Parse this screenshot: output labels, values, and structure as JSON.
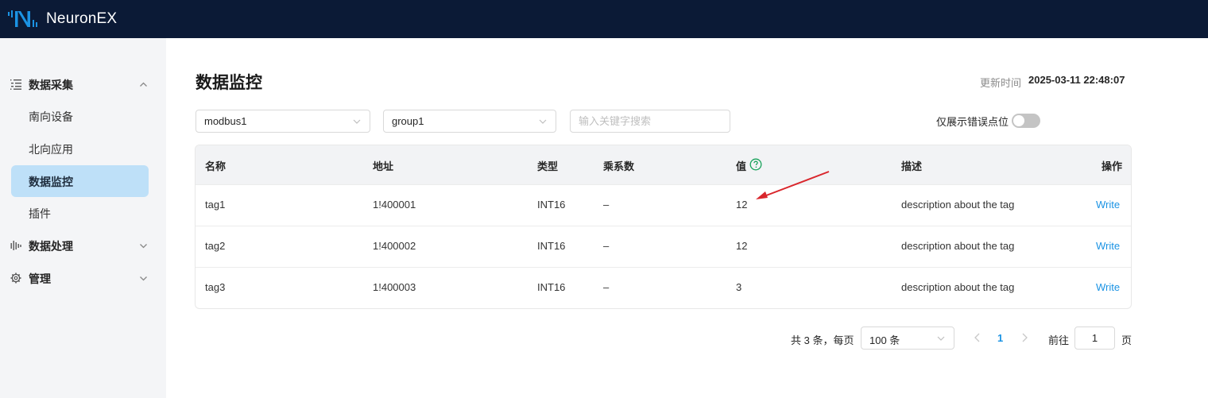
{
  "app": {
    "name": "NeuronEX"
  },
  "sidebar": {
    "groups": [
      {
        "label": "数据采集",
        "items": [
          {
            "label": "南向设备"
          },
          {
            "label": "北向应用"
          },
          {
            "label": "数据监控",
            "active": true
          },
          {
            "label": "插件"
          }
        ]
      },
      {
        "label": "数据处理"
      },
      {
        "label": "管理"
      }
    ]
  },
  "page": {
    "title": "数据监控",
    "update_label": "更新时间",
    "update_time": "2025-03-11 22:48:07"
  },
  "filters": {
    "node": "modbus1",
    "group": "group1",
    "search_placeholder": "输入关键字搜索",
    "error_only_label": "仅展示错误点位",
    "error_only": false
  },
  "table": {
    "columns": [
      "名称",
      "地址",
      "类型",
      "乘系数",
      "值",
      "描述",
      "操作"
    ],
    "rows": [
      {
        "name": "tag1",
        "address": "1!400001",
        "type": "INT16",
        "multiplier": "–",
        "value": "12",
        "description": "description about the tag",
        "action": "Write"
      },
      {
        "name": "tag2",
        "address": "1!400002",
        "type": "INT16",
        "multiplier": "–",
        "value": "12",
        "description": "description about the tag",
        "action": "Write"
      },
      {
        "name": "tag3",
        "address": "1!400003",
        "type": "INT16",
        "multiplier": "–",
        "value": "3",
        "description": "description about the tag",
        "action": "Write"
      }
    ]
  },
  "pagination": {
    "total_text": "共 3 条，每页",
    "page_size": "100 条",
    "current_page": "1",
    "goto_label": "前往",
    "goto_value": "1",
    "page_suffix": "页"
  },
  "colors": {
    "topbar": "#0b1a36",
    "accent": "#1b93e4",
    "active_menu": "#bee0f8",
    "annotation_arrow": "#d9262c"
  }
}
